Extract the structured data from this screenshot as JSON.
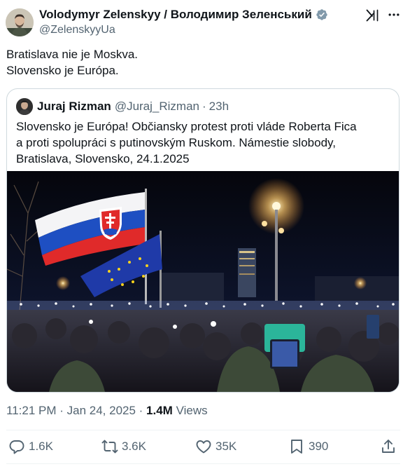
{
  "author": {
    "display_name": "Volodymyr Zelenskyy / Володимир Зеленський",
    "handle": "@ZelenskyyUa"
  },
  "tweet": {
    "lines": [
      "Bratislava nie je Moskva.",
      "Slovensko je Európa."
    ]
  },
  "quote": {
    "name": "Juraj Rizman",
    "handle": "@Juraj_Rizman",
    "separator": "·",
    "time": "23h",
    "lines": [
      "Slovensko je Európa! Občiansky protest proti vláde Roberta Fica",
      "a proti spolupráci s putinovským Ruskom. Námestie slobody,",
      "Bratislava, Slovensko, 24.1.2025"
    ]
  },
  "meta": {
    "time": "11:21 PM",
    "sep1": " · ",
    "date": "Jan 24, 2025",
    "sep2": " · ",
    "views": "1.4M",
    "views_label": " Views"
  },
  "actions": {
    "replies": "1.6K",
    "reposts": "3.6K",
    "likes": "35K",
    "bookmarks": "390"
  },
  "icons": {
    "verified": "verified-badge-icon",
    "grok": "x-grok-icon",
    "more": "more-icon",
    "reply": "reply-icon",
    "repost": "repost-icon",
    "like": "heart-icon",
    "bookmark": "bookmark-icon",
    "share": "share-icon"
  },
  "colors": {
    "text": "#0f1419",
    "secondary": "#536471",
    "border": "#cfd9de",
    "verified_gray": "#829aab"
  }
}
